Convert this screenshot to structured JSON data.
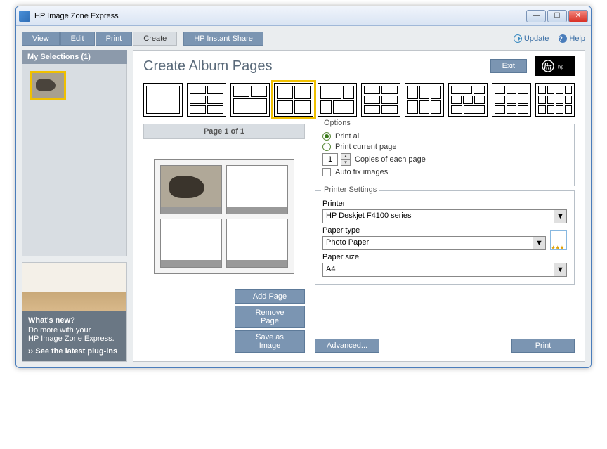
{
  "window": {
    "title": "HP Image Zone Express"
  },
  "menubar": {
    "tabs": [
      "View",
      "Edit",
      "Print",
      "Create"
    ],
    "active_tab": "Create",
    "alt_tab": "HP Instant Share",
    "update": "Update",
    "help": "Help"
  },
  "sidebar": {
    "header": "My Selections (1)",
    "promo": {
      "title": "What's new?",
      "line1": "Do more with your",
      "line2": "HP Image Zone Express.",
      "link": "›› See the latest plug-ins"
    }
  },
  "main": {
    "title": "Create Album Pages",
    "exit": "Exit",
    "page_indicator": "Page 1 of 1",
    "buttons": {
      "add": "Add Page",
      "remove": "Remove Page",
      "save": "Save as Image"
    }
  },
  "options": {
    "legend": "Options",
    "print_all": "Print all",
    "print_current": "Print current page",
    "copies_value": "1",
    "copies_label": "Copies of each page",
    "autofix": "Auto fix images"
  },
  "printer": {
    "legend": "Printer Settings",
    "printer_label": "Printer",
    "printer_value": "HP Deskjet F4100 series",
    "paper_type_label": "Paper type",
    "paper_type_value": "Photo Paper",
    "paper_size_label": "Paper size",
    "paper_size_value": "A4",
    "advanced": "Advanced...",
    "print": "Print"
  }
}
